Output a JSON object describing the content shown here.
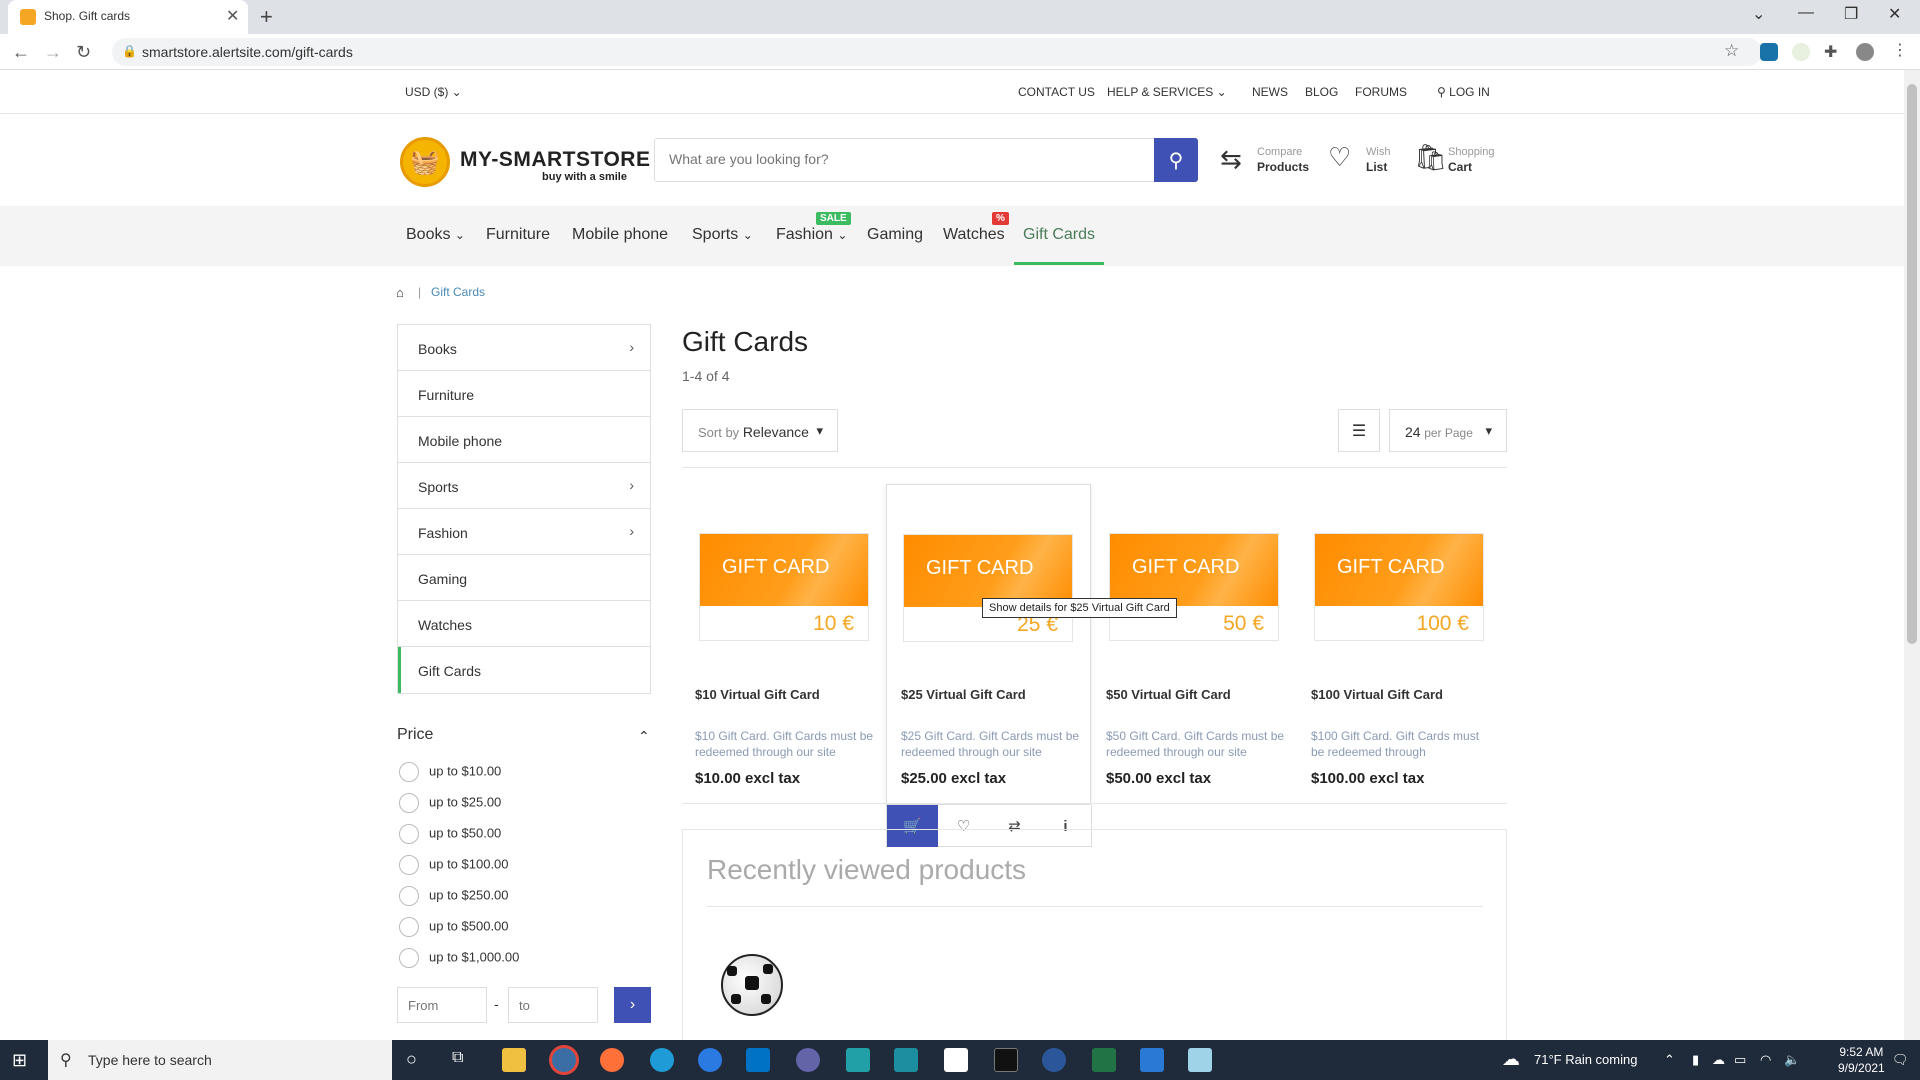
{
  "browser": {
    "tab_title": "Shop. Gift cards",
    "url": "smartstore.alertsite.com/gift-cards"
  },
  "utility": {
    "currency": "USD ($)",
    "contact": "CONTACT US",
    "help": "HELP & SERVICES",
    "news": "NEWS",
    "blog": "BLOG",
    "forums": "FORUMS",
    "login": "LOG IN"
  },
  "header": {
    "logo_name": "MY-SMARTSTORE",
    "logo_tagline": "buy with a smile",
    "search_placeholder": "What are you looking for?",
    "compare_small": "Compare",
    "compare_big": "Products",
    "wish_small": "Wish",
    "wish_big": "List",
    "cart_small": "Shopping",
    "cart_big": "Cart"
  },
  "catnav": {
    "items": [
      "Books",
      "Furniture",
      "Mobile phone",
      "Sports",
      "Fashion",
      "Gaming",
      "Watches",
      "Gift Cards"
    ],
    "sale_badge": "SALE",
    "pct_badge": "%"
  },
  "breadcrumb": {
    "separator": "|",
    "current": "Gift Cards"
  },
  "sidebar": {
    "items": [
      "Books",
      "Furniture",
      "Mobile phone",
      "Sports",
      "Fashion",
      "Gaming",
      "Watches",
      "Gift Cards"
    ],
    "price_title": "Price",
    "price_options": [
      "up to $10.00",
      "up to $25.00",
      "up to $50.00",
      "up to $100.00",
      "up to $250.00",
      "up to $500.00",
      "up to $1,000.00"
    ],
    "from_placeholder": "From",
    "to_placeholder": "to",
    "range_dash": "-"
  },
  "main": {
    "title": "Gift Cards",
    "count": "1-4 of 4",
    "sort_prefix": "Sort by",
    "sort_value": "Relevance",
    "per_page_value": "24",
    "per_page_label": "per Page",
    "gift_card_label": "GIFT CARD",
    "products": [
      {
        "value": "10 €",
        "name": "$10 Virtual Gift Card",
        "desc": "$10 Gift Card. Gift Cards must be redeemed through our site",
        "price": "$10.00 excl tax"
      },
      {
        "value": "25 €",
        "name": "$25 Virtual Gift Card",
        "desc": "$25 Gift Card. Gift Cards must be redeemed through our site",
        "price": "$25.00 excl tax"
      },
      {
        "value": "50 €",
        "name": "$50 Virtual Gift Card",
        "desc": "$50 Gift Card. Gift Cards must be redeemed through our site",
        "price": "$50.00 excl tax"
      },
      {
        "value": "100 €",
        "name": "$100 Virtual Gift Card",
        "desc": "$100 Gift Card. Gift Cards must be redeemed through",
        "price": "$100.00 excl tax"
      }
    ],
    "tooltip": "Show details for $25 Virtual Gift Card",
    "recent_title": "Recently viewed products"
  },
  "taskbar": {
    "search_text": "Type here to search",
    "weather": "71°F  Rain coming",
    "time": "9:52 AM",
    "date": "9/9/2021"
  },
  "colors": {
    "accent": "#3f51b5",
    "active_green": "#3dbb61",
    "gift_orange": "#ff8c00"
  }
}
